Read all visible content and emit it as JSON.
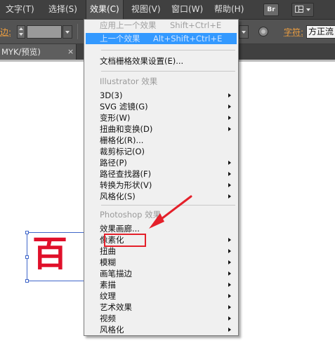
{
  "menubar": {
    "items": [
      "文字(T)",
      "选择(S)",
      "效果(C)",
      "视图(V)",
      "窗口(W)",
      "帮助(H)"
    ],
    "bridge_label": "Br"
  },
  "controlbar": {
    "stroke_label": "边:",
    "char_label": "字符:",
    "font_value": "方正流"
  },
  "tab": {
    "title": "MYK/预览)",
    "close": "×"
  },
  "artwork": {
    "text": "百"
  },
  "effect_menu": {
    "apply_last": {
      "label": "应用上一个效果",
      "shortcut": "Shift+Ctrl+E"
    },
    "last_effect": {
      "label": "上一个效果",
      "shortcut": "Alt+Shift+Ctrl+E"
    },
    "raster_settings": "文档栅格效果设置(E)...",
    "illustrator_header": "Illustrator 效果",
    "illustrator_items": [
      {
        "label": "3D(3)",
        "submenu": true
      },
      {
        "label": "SVG 滤镜(G)",
        "submenu": true
      },
      {
        "label": "变形(W)",
        "submenu": true
      },
      {
        "label": "扭曲和变换(D)",
        "submenu": true
      },
      {
        "label": "栅格化(R)...",
        "submenu": false
      },
      {
        "label": "裁剪标记(O)",
        "submenu": false
      },
      {
        "label": "路径(P)",
        "submenu": true
      },
      {
        "label": "路径查找器(F)",
        "submenu": true
      },
      {
        "label": "转换为形状(V)",
        "submenu": true
      },
      {
        "label": "风格化(S)",
        "submenu": true
      }
    ],
    "photoshop_header": "Photoshop 效果",
    "photoshop_items": [
      {
        "label": "效果画廊...",
        "submenu": false
      },
      {
        "label": "像素化",
        "submenu": true
      },
      {
        "label": "扭曲",
        "submenu": true
      },
      {
        "label": "模糊",
        "submenu": true
      },
      {
        "label": "画笔描边",
        "submenu": true
      },
      {
        "label": "素描",
        "submenu": true
      },
      {
        "label": "纹理",
        "submenu": true
      },
      {
        "label": "艺术效果",
        "submenu": true
      },
      {
        "label": "视频",
        "submenu": true
      },
      {
        "label": "风格化",
        "submenu": true
      }
    ]
  },
  "colors": {
    "menubar_bg": "#404040",
    "highlight": "#3399ff",
    "annotation_red": "#e4202a",
    "artwork_red": "#e0102a"
  }
}
